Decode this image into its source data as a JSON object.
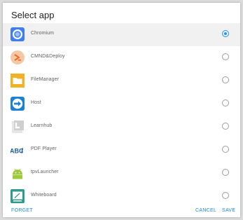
{
  "dialog": {
    "title": "Select app",
    "apps": [
      {
        "label": "Chromium",
        "icon": "chromium-icon",
        "selected": true
      },
      {
        "label": "CMND&Deploy",
        "icon": "cmnd-deploy-icon",
        "selected": false
      },
      {
        "label": "FileManager",
        "icon": "folder-icon",
        "selected": false
      },
      {
        "label": "Host",
        "icon": "host-icon",
        "selected": false
      },
      {
        "label": "Learnhub",
        "icon": "learnhub-icon",
        "selected": false
      },
      {
        "label": "PDF Player",
        "icon": "pdf-player-icon",
        "selected": false
      },
      {
        "label": "tpvLauncher",
        "icon": "android-icon",
        "selected": false
      },
      {
        "label": "Whiteboard",
        "icon": "whiteboard-icon",
        "selected": false
      }
    ],
    "buttons": {
      "forget": "FORGET",
      "cancel": "CANCEL",
      "save": "SAVE"
    },
    "colors": {
      "accent": "#2196f3",
      "button_text": "#1e88e5"
    }
  }
}
